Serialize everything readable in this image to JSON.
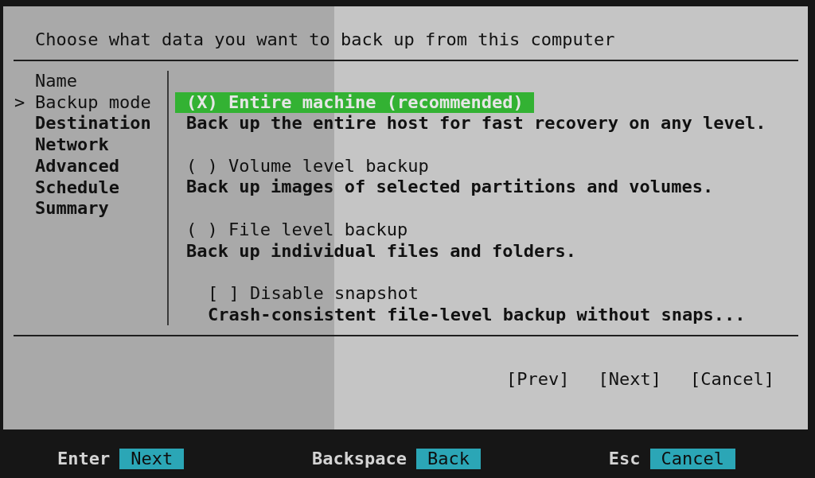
{
  "dialog": {
    "title": "Choose what data you want to back up from this computer"
  },
  "step_pointer": ">",
  "steps": [
    {
      "label": "Name",
      "selected": false,
      "visited": true
    },
    {
      "label": "Backup mode",
      "selected": true,
      "visited": true
    },
    {
      "label": "Destination",
      "selected": false,
      "visited": false
    },
    {
      "label": "Network",
      "selected": false,
      "visited": false
    },
    {
      "label": "Advanced",
      "selected": false,
      "visited": false
    },
    {
      "label": "Schedule",
      "selected": false,
      "visited": false
    },
    {
      "label": "Summary",
      "selected": false,
      "visited": false
    }
  ],
  "options": [
    {
      "kind": "radio",
      "marker": "(X)",
      "label": "Entire machine (recommended)",
      "selected": true,
      "description": "Back up the entire host for fast recovery on any level."
    },
    {
      "kind": "radio",
      "marker": "( )",
      "label": "Volume level backup",
      "selected": false,
      "description": "Back up images of selected partitions and volumes."
    },
    {
      "kind": "radio",
      "marker": "( )",
      "label": "File level backup",
      "selected": false,
      "description": "Back up individual files and folders."
    },
    {
      "kind": "checkbox",
      "marker": "[ ]",
      "label": "Disable snapshot",
      "checked": false,
      "description": "Crash-consistent file-level backup without snaps..."
    }
  ],
  "buttons": [
    "[Prev]",
    "[Next]",
    "[Cancel]"
  ],
  "key_hints": [
    {
      "key": "Enter",
      "action": "Next"
    },
    {
      "key": "Backspace",
      "action": "Back"
    },
    {
      "key": "Esc",
      "action": "Cancel"
    }
  ]
}
